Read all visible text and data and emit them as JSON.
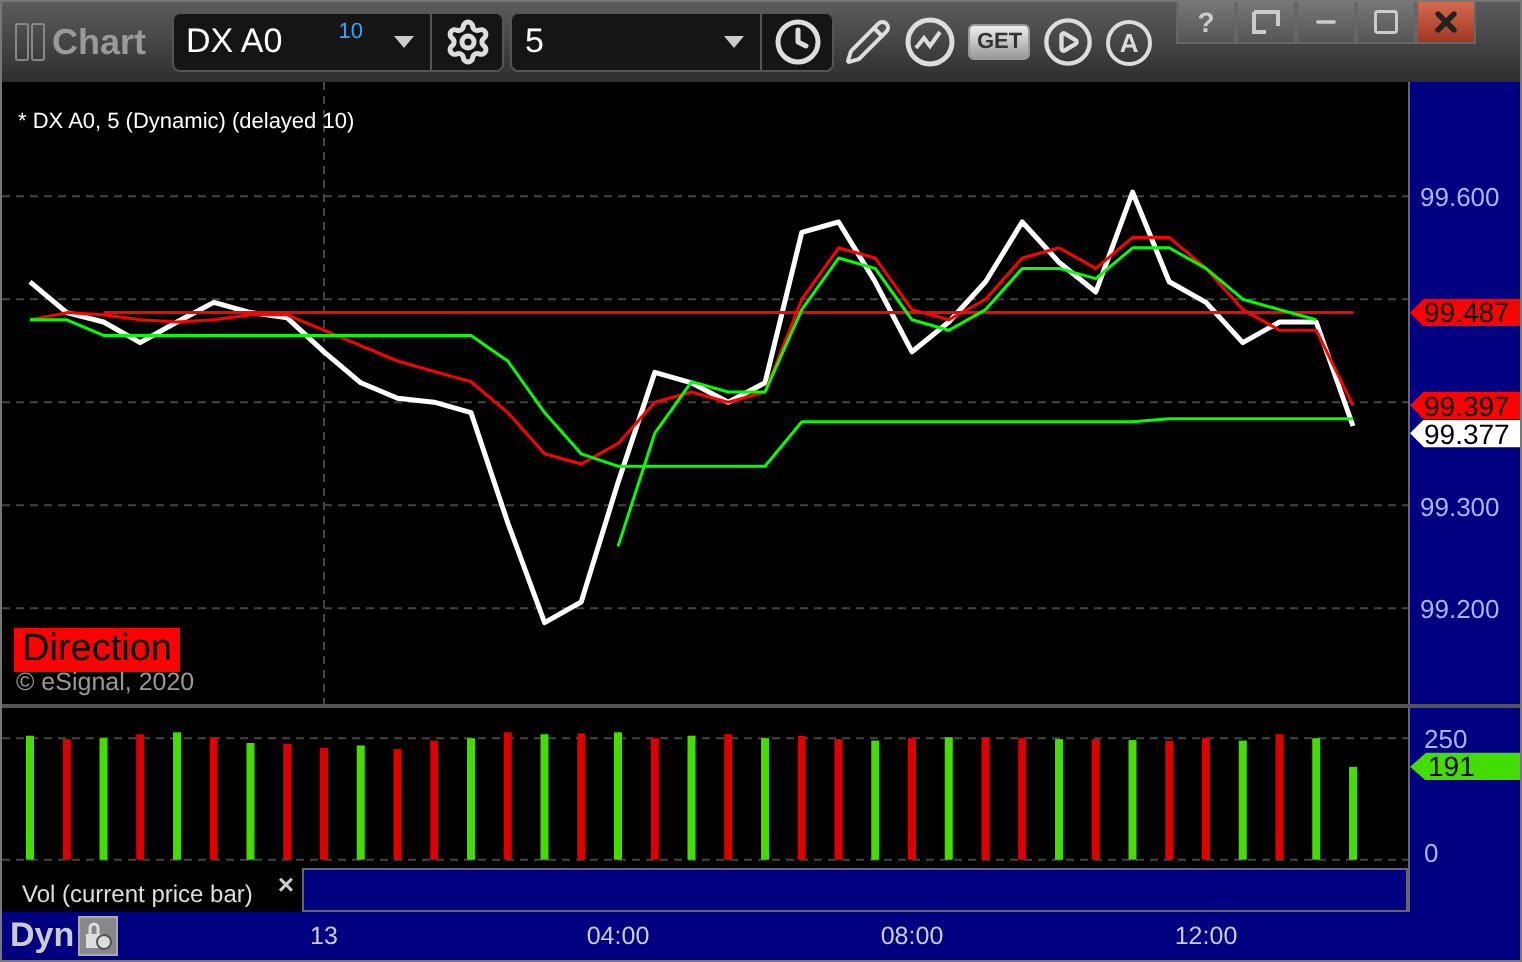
{
  "window": {
    "title": "Chart",
    "buttons": [
      {
        "kind": "help",
        "label": "?"
      },
      {
        "kind": "dock"
      },
      {
        "kind": "minimize"
      },
      {
        "kind": "maximize"
      },
      {
        "kind": "close"
      }
    ]
  },
  "toolbar": {
    "symbol": "DX A0",
    "symbol_badge": "10",
    "interval": "5",
    "tools": [
      {
        "kind": "clock"
      },
      {
        "kind": "pencil"
      },
      {
        "kind": "studies"
      },
      {
        "kind": "get",
        "label": "GET"
      },
      {
        "kind": "play"
      },
      {
        "kind": "alert",
        "label": "A"
      }
    ]
  },
  "chart": {
    "legend": "* DX A0, 5 (Dynamic) (delayed 10)",
    "badge": "Direction",
    "copyright": "© eSignal, 2020",
    "price_labels": [
      {
        "text": "99.487",
        "color": "#ff0000"
      },
      {
        "text": "99.397",
        "color": "#ff0000"
      },
      {
        "text": "99.377",
        "color": "#ffffff"
      }
    ],
    "chart_data": {
      "type": "line",
      "ylim": [
        99.107,
        99.711
      ],
      "categories": [
        null,
        null,
        null,
        null,
        null,
        null,
        null,
        null,
        null,
        null,
        null,
        null,
        null,
        null,
        null,
        null,
        null,
        null,
        null,
        null,
        null,
        null,
        null,
        null,
        null,
        null,
        null,
        null,
        null,
        null,
        null,
        null,
        null,
        null,
        null,
        null,
        null
      ],
      "grid": true,
      "yticks": [
        {
          "value": 99.2,
          "label": "99.200"
        },
        {
          "value": 99.3,
          "label": "99.300"
        },
        {
          "value": 99.6,
          "label": "99.600"
        }
      ],
      "series": [
        {
          "color": "#ffffff",
          "values": [
            99.517,
            99.487,
            99.478,
            99.458,
            99.478,
            99.497,
            99.487,
            99.482,
            99.449,
            99.419,
            99.404,
            99.4,
            99.39,
            99.283,
            99.186,
            99.206,
            99.322,
            99.429,
            99.419,
            99.4,
            99.419,
            99.565,
            99.575,
            99.517,
            99.449,
            99.478,
            99.517,
            99.575,
            99.536,
            99.507,
            99.604,
            99.517,
            99.497,
            99.458,
            99.478,
            99.478,
            99.377
          ]
        },
        {
          "color": "#ff0000",
          "values": [
            99.48,
            99.487,
            99.485,
            99.48,
            99.478,
            99.48,
            99.485,
            99.485,
            99.47,
            99.455,
            99.44,
            99.43,
            99.42,
            99.39,
            99.35,
            99.34,
            99.36,
            99.4,
            99.41,
            99.4,
            99.41,
            99.5,
            99.55,
            99.54,
            99.49,
            99.48,
            99.5,
            99.54,
            99.55,
            99.53,
            99.56,
            99.56,
            99.53,
            99.49,
            99.47,
            99.47,
            99.397
          ]
        },
        {
          "color": "#ff0000",
          "values": [
            null,
            null,
            99.487,
            99.487,
            99.487,
            99.487,
            99.487,
            99.487,
            99.487,
            99.487,
            99.487,
            99.487,
            99.487,
            99.487,
            99.487,
            99.487,
            99.487,
            99.487,
            99.487,
            99.487,
            99.487,
            99.487,
            99.487,
            99.487,
            99.487,
            99.487,
            99.487,
            99.487,
            99.487,
            99.487,
            99.487,
            99.487,
            99.487,
            99.487,
            99.487,
            99.487,
            99.487
          ]
        },
        {
          "color": "#00ff00",
          "values": [
            99.48,
            99.48,
            99.465,
            99.465,
            99.465,
            99.465,
            99.465,
            99.465,
            99.465,
            99.465,
            99.465,
            99.465,
            99.465,
            99.44,
            99.39,
            99.35,
            99.338,
            99.338,
            99.338,
            99.338,
            99.338,
            99.381,
            99.381,
            99.381,
            99.381,
            99.381,
            99.381,
            99.381,
            99.381,
            99.381,
            99.381,
            99.384,
            99.384,
            99.384,
            99.384,
            99.384,
            99.384
          ]
        },
        {
          "color": "#00ff00",
          "values": [
            null,
            null,
            null,
            null,
            null,
            null,
            null,
            null,
            null,
            null,
            null,
            null,
            null,
            null,
            null,
            null,
            99.26,
            99.37,
            99.42,
            99.41,
            99.41,
            99.49,
            99.54,
            99.53,
            99.48,
            99.47,
            99.49,
            99.53,
            99.53,
            99.52,
            99.55,
            99.55,
            99.53,
            99.5,
            99.49,
            99.48,
            null
          ]
        }
      ]
    }
  },
  "volume": {
    "label": "Vol (current price bar)",
    "close": "×",
    "reading": "191",
    "chart_data": {
      "type": "bar",
      "stacked": true,
      "ylim": [
        -17,
        312
      ],
      "categories": [
        null,
        null,
        null,
        null,
        null,
        null,
        null,
        null,
        null,
        null,
        null,
        null,
        null,
        null,
        null,
        null,
        null,
        null,
        null,
        null,
        null,
        null,
        null,
        null,
        null,
        null,
        null,
        null,
        null,
        null,
        null,
        null,
        null,
        null,
        null,
        null,
        null
      ],
      "grid": true,
      "yticks": [
        {
          "value": 0,
          "label": "0"
        },
        {
          "value": 250,
          "label": "250"
        }
      ],
      "series": [
        {
          "color": "#44dd00",
          "values": [
            255,
            null,
            250,
            null,
            262,
            null,
            240,
            null,
            null,
            235,
            null,
            null,
            250,
            null,
            258,
            null,
            262,
            null,
            255,
            null,
            250,
            null,
            null,
            245,
            null,
            252,
            null,
            null,
            248,
            null,
            246,
            null,
            null,
            245,
            null,
            250,
            191
          ]
        },
        {
          "color": "#dd0000",
          "values": [
            null,
            248,
            null,
            258,
            null,
            252,
            null,
            238,
            230,
            null,
            228,
            245,
            null,
            262,
            null,
            260,
            null,
            250,
            null,
            258,
            null,
            255,
            248,
            null,
            250,
            null,
            252,
            250,
            null,
            248,
            null,
            245,
            250,
            null,
            258,
            null,
            null
          ]
        }
      ]
    }
  },
  "time_axis": {
    "mode": "Dyn",
    "labels": [
      "13",
      "04:00",
      "08:00",
      "12:00"
    ]
  }
}
